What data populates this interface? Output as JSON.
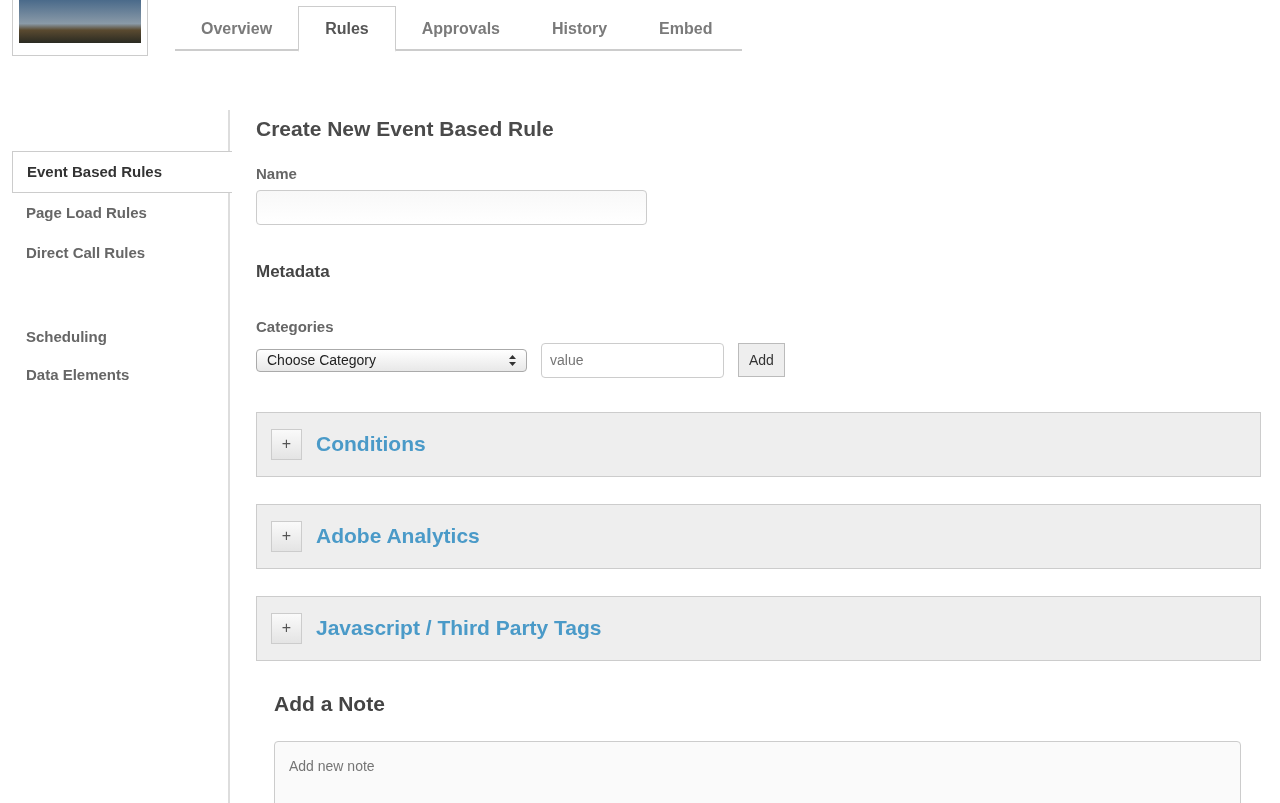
{
  "tabs": [
    {
      "label": "Overview",
      "selected": false
    },
    {
      "label": "Rules",
      "selected": true
    },
    {
      "label": "Approvals",
      "selected": false
    },
    {
      "label": "History",
      "selected": false
    },
    {
      "label": "Embed",
      "selected": false
    }
  ],
  "sidebar": {
    "sections": [
      {
        "items": [
          {
            "label": "Event Based Rules",
            "selected": true
          },
          {
            "label": "Page Load Rules",
            "selected": false
          },
          {
            "label": "Direct Call Rules",
            "selected": false
          }
        ]
      },
      {
        "items": [
          {
            "label": "Scheduling",
            "selected": false
          },
          {
            "label": "Data Elements",
            "selected": false
          }
        ]
      }
    ]
  },
  "form": {
    "title": "Create New Event Based Rule",
    "name_label": "Name",
    "metadata_heading": "Metadata",
    "categories_label": "Categories",
    "category_select": "Choose Category",
    "value_placeholder": "value",
    "add_button": "Add"
  },
  "panels": [
    {
      "toggle": "+",
      "title": "Conditions",
      "expanded": false
    },
    {
      "toggle": "+",
      "title": "Adobe Analytics",
      "expanded": false
    },
    {
      "toggle": "+",
      "title": "Javascript / Third Party Tags",
      "expanded": false
    }
  ],
  "note": {
    "heading": "Add a Note",
    "placeholder": "Add new note"
  }
}
